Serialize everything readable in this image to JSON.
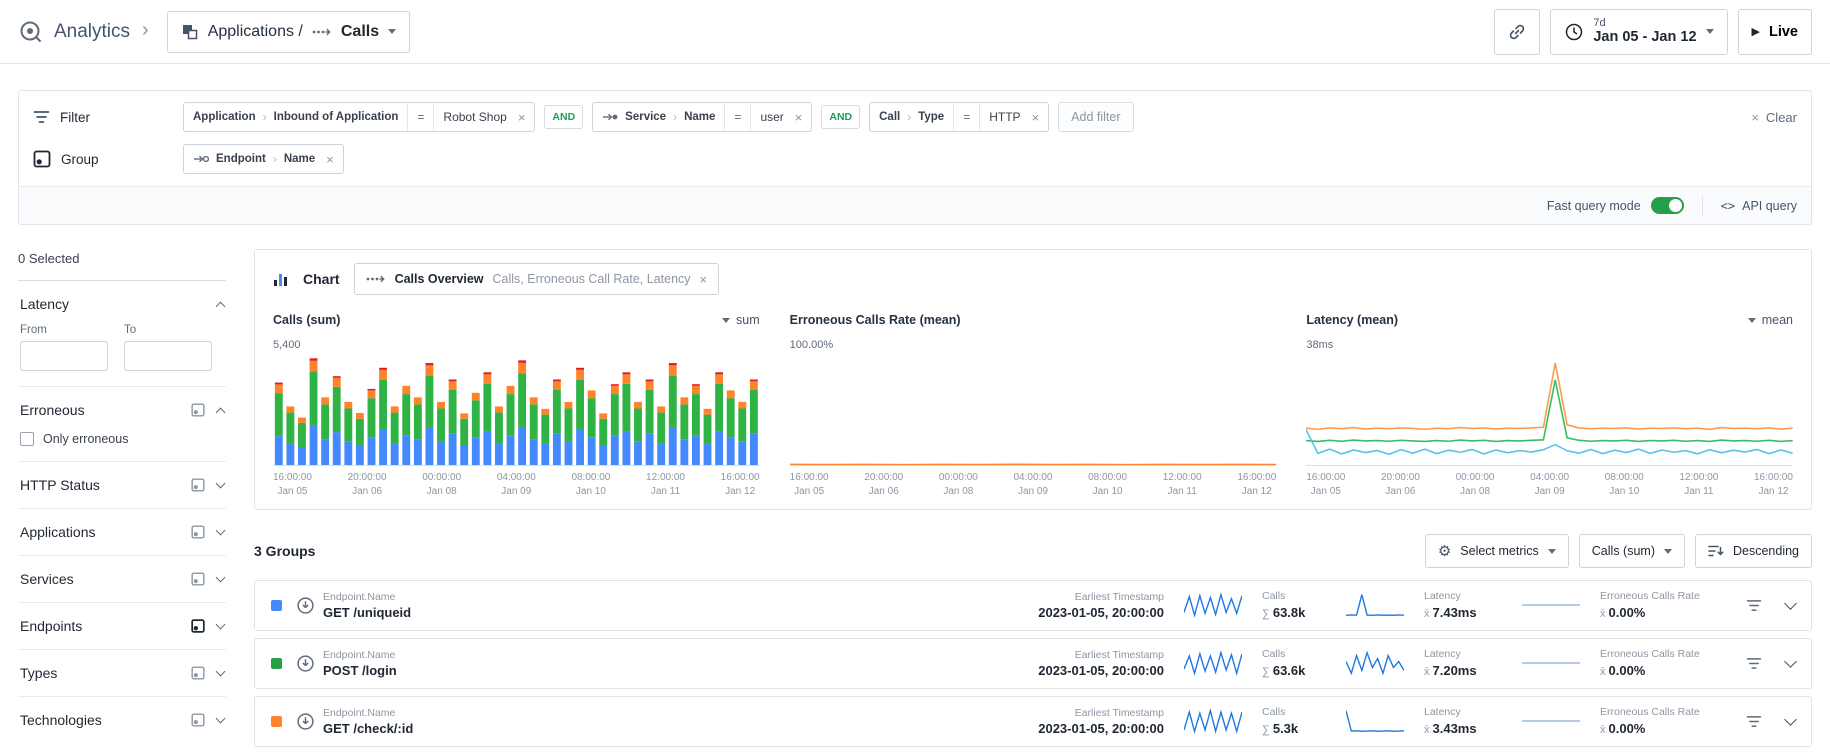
{
  "symbols": {
    "close": "×",
    "sum": "∑",
    "mean": "x̄",
    "api_icon": "<>",
    "crumb": "›"
  },
  "header": {
    "brand": "Analytics",
    "app_label": "Applications /",
    "page_label": "Calls",
    "time_range": {
      "duration": "7d",
      "range": "Jan 05 - Jan 12"
    },
    "live_label": "Live"
  },
  "filter_bar": {
    "filter_label": "Filter",
    "and_label": "AND",
    "add_filter_placeholder": "Add filter",
    "clear_label": "Clear",
    "chips": [
      {
        "entity": "Application",
        "field": "Inbound of Application",
        "op": "=",
        "value": "Robot Shop"
      },
      {
        "entity": "Service",
        "field": "Name",
        "op": "=",
        "value": "user"
      },
      {
        "entity": "Call",
        "field": "Type",
        "op": "=",
        "value": "HTTP"
      }
    ],
    "group_label": "Group",
    "group_chip": {
      "entity": "Endpoint",
      "field": "Name"
    },
    "fast_query_label": "Fast query mode",
    "api_query_label": "API query"
  },
  "sidebar": {
    "selected_count": "0 Selected",
    "latency": {
      "label": "Latency",
      "from_label": "From",
      "to_label": "To"
    },
    "erroneous": {
      "label": "Erroneous",
      "checkbox_label": "Only erroneous"
    },
    "collapsed": [
      {
        "label": "HTTP Status"
      },
      {
        "label": "Applications"
      },
      {
        "label": "Services"
      },
      {
        "label": "Endpoints",
        "active": true
      },
      {
        "label": "Types"
      },
      {
        "label": "Technologies"
      }
    ]
  },
  "chart_card": {
    "title": "Chart",
    "chip_title": "Calls Overview",
    "chip_subtitle": "Calls, Erroneous Call Rate, Latency",
    "panels": [
      {
        "title": "Calls (sum)",
        "agg": "sum",
        "ymax_label": "5,400"
      },
      {
        "title": "Erroneous Calls Rate (mean)",
        "ymax_label": "100.00%"
      },
      {
        "title": "Latency (mean)",
        "agg": "mean",
        "ymax_label": "38ms"
      }
    ],
    "x_ticks": [
      [
        "16:00:00",
        "Jan 05"
      ],
      [
        "20:00:00",
        "Jan 06"
      ],
      [
        "00:00:00",
        "Jan 08"
      ],
      [
        "04:00:00",
        "Jan 09"
      ],
      [
        "08:00:00",
        "Jan 10"
      ],
      [
        "12:00:00",
        "Jan 11"
      ],
      [
        "16:00:00",
        "Jan 12"
      ]
    ]
  },
  "groups": {
    "title": "3 Groups",
    "select_metrics_label": "Select metrics",
    "sort_metric_label": "Calls (sum)",
    "sort_dir_label": "Descending",
    "rows": [
      {
        "color": "#4589ff",
        "entity_label": "Endpoint.Name",
        "name": "GET /uniqueid",
        "timestamp_label": "Earliest Timestamp",
        "timestamp": "2023-01-05, 20:00:00",
        "calls_label": "Calls",
        "calls_value": "63.8k",
        "latency_label": "Latency",
        "latency_value": "7.43ms",
        "erroneous_label": "Erroneous Calls Rate",
        "erroneous_value": "0.00%"
      },
      {
        "color": "#24a148",
        "entity_label": "Endpoint.Name",
        "name": "POST /login",
        "timestamp_label": "Earliest Timestamp",
        "timestamp": "2023-01-05, 20:00:00",
        "calls_label": "Calls",
        "calls_value": "63.6k",
        "latency_label": "Latency",
        "latency_value": "7.20ms",
        "erroneous_label": "Erroneous Calls Rate",
        "erroneous_value": "0.00%"
      },
      {
        "color": "#ff832b",
        "entity_label": "Endpoint.Name",
        "name": "GET /check/:id",
        "timestamp_label": "Earliest Timestamp",
        "timestamp": "2023-01-05, 20:00:00",
        "calls_label": "Calls",
        "calls_value": "5.3k",
        "latency_label": "Latency",
        "latency_value": "3.43ms",
        "erroneous_label": "Erroneous Calls Rate",
        "erroneous_value": "0.00%"
      }
    ]
  },
  "chart_data": [
    {
      "type": "bar",
      "title": "Calls (sum)",
      "stacked": true,
      "ylim": [
        0,
        5400
      ],
      "series": [
        {
          "name": "GET /uniqueid",
          "color": "#4589ff",
          "values": [
            1400,
            1050,
            850,
            1950,
            1250,
            1600,
            1150,
            950,
            1350,
            1750,
            1050,
            1450,
            1250,
            1850,
            1150,
            1550,
            950,
            1350,
            1650,
            1050,
            1450,
            1850,
            1250,
            1050,
            1550,
            1150,
            1750,
            1350,
            950,
            1450,
            1650,
            1150,
            1550,
            1050,
            1850,
            1250,
            1450,
            1050,
            1650,
            1350,
            1150,
            1550
          ]
        },
        {
          "name": "POST /login",
          "color": "#2fb344",
          "values": [
            2100,
            1500,
            1200,
            2600,
            1700,
            2200,
            1600,
            1300,
            1900,
            2400,
            1500,
            2000,
            1700,
            2500,
            1600,
            2100,
            1300,
            1800,
            2300,
            1500,
            2000,
            2600,
            1700,
            1400,
            2100,
            1600,
            2400,
            1900,
            1300,
            2000,
            2300,
            1600,
            2100,
            1500,
            2500,
            1700,
            2000,
            1400,
            2300,
            1900,
            1600,
            2100
          ]
        },
        {
          "name": "GET /check/:id",
          "color": "#ff832b",
          "values": [
            420,
            300,
            260,
            520,
            340,
            440,
            320,
            280,
            380,
            480,
            300,
            400,
            340,
            500,
            320,
            420,
            260,
            360,
            460,
            300,
            400,
            520,
            340,
            280,
            420,
            320,
            480,
            380,
            260,
            400,
            460,
            320,
            420,
            300,
            500,
            340,
            400,
            280,
            460,
            380,
            320,
            420
          ]
        },
        {
          "name": "erroneous",
          "color": "#da1e28",
          "values": [
            90,
            0,
            0,
            120,
            0,
            80,
            0,
            0,
            70,
            100,
            0,
            0,
            0,
            110,
            0,
            90,
            0,
            0,
            100,
            0,
            0,
            120,
            0,
            0,
            90,
            0,
            100,
            0,
            0,
            80,
            100,
            0,
            90,
            0,
            110,
            0,
            80,
            0,
            100,
            0,
            0,
            90
          ]
        }
      ]
    },
    {
      "type": "line",
      "title": "Erroneous Calls Rate (mean)",
      "ylim": [
        0,
        100
      ],
      "series": [
        {
          "name": "rate",
          "color": "#ff832b",
          "values": [
            0.5,
            0.4,
            0.5,
            0.3,
            0.5,
            0.4,
            0.6,
            0.4,
            0.5,
            0.3,
            0.5,
            0.4,
            0.5,
            0.4
          ]
        }
      ]
    },
    {
      "type": "line",
      "title": "Latency (mean)",
      "ylim": [
        0,
        38
      ],
      "series": [
        {
          "name": "GET /check/:id",
          "color": "#ff9b4e",
          "values": [
            13,
            12.6,
            13.1,
            12.8,
            13.2,
            12.7,
            13,
            12.8,
            13.1,
            12.9,
            12.6,
            13,
            12.8,
            13.2,
            12.9,
            13.1,
            12.7,
            13,
            12.9,
            13.1,
            13.3,
            36,
            14.2,
            13.1,
            12.8,
            13,
            12.9,
            13.1,
            12.7,
            13,
            12.9,
            13.1,
            12.8,
            13,
            12.6,
            13.2,
            12.9,
            13,
            12.8,
            13.1,
            12.7,
            13
          ]
        },
        {
          "name": "POST /login",
          "color": "#3dbb61",
          "values": [
            8.6,
            8.3,
            8.7,
            8.4,
            8.8,
            8.5,
            8.6,
            8.4,
            8.7,
            8.5,
            8.3,
            8.6,
            8.4,
            8.8,
            8.5,
            8.7,
            8.3,
            8.6,
            8.5,
            8.7,
            8.9,
            30,
            9.6,
            8.7,
            8.4,
            8.6,
            8.5,
            8.7,
            8.3,
            8.6,
            8.5,
            8.7,
            8.4,
            8.6,
            8.3,
            8.8,
            8.5,
            8.6,
            8.4,
            8.7,
            8.3,
            8.6
          ]
        },
        {
          "name": "GET /uniqueid",
          "color": "#56c4e8",
          "values": [
            12.5,
            4.1,
            5.6,
            3.9,
            5.3,
            4.4,
            5.1,
            3.8,
            5.4,
            4.2,
            5.6,
            4.0,
            5.2,
            4.5,
            5.5,
            3.9,
            5.3,
            4.3,
            5.1,
            4.6,
            5.4,
            7.2,
            5.0,
            4.2,
            5.5,
            4.0,
            5.2,
            4.4,
            5.6,
            4.1,
            5.3,
            4.5,
            5.1,
            3.9,
            5.4,
            4.3,
            5.2,
            4.6,
            5.5,
            4.0,
            5.3,
            4.2
          ]
        }
      ]
    },
    {
      "type": "sparklines",
      "rows": [
        {
          "calls": [
            58,
            74,
            55,
            75,
            57,
            73,
            56,
            76,
            58,
            72,
            57,
            75
          ],
          "latency": [
            7,
            7.3,
            7.1,
            24,
            7.2,
            7,
            7.3,
            7.1,
            7.2,
            7,
            7.3,
            7.1
          ],
          "erroneous": [
            0,
            0,
            0,
            0,
            0,
            0,
            0,
            0,
            0,
            0,
            0,
            0
          ]
        },
        {
          "calls": [
            60,
            72,
            56,
            74,
            58,
            72,
            57,
            75,
            59,
            73,
            56,
            74
          ],
          "latency": [
            7.2,
            6.8,
            7.4,
            6.9,
            7.5,
            7,
            7.3,
            6.8,
            7.4,
            7,
            7.2,
            6.9
          ],
          "erroneous": [
            0,
            0,
            0,
            0,
            0,
            0,
            0,
            0,
            0,
            0,
            0,
            0
          ]
        },
        {
          "calls": [
            28,
            42,
            27,
            41,
            28,
            43,
            27,
            42,
            28,
            41,
            27,
            42
          ],
          "latency": [
            12,
            3.4,
            3.5,
            3.3,
            3.4,
            3.5,
            3.3,
            3.4,
            3.5,
            3.3,
            3.4,
            3.5
          ],
          "erroneous": [
            0,
            0,
            0,
            0,
            0,
            0,
            0,
            0,
            0,
            0,
            0,
            0
          ]
        }
      ]
    }
  ]
}
